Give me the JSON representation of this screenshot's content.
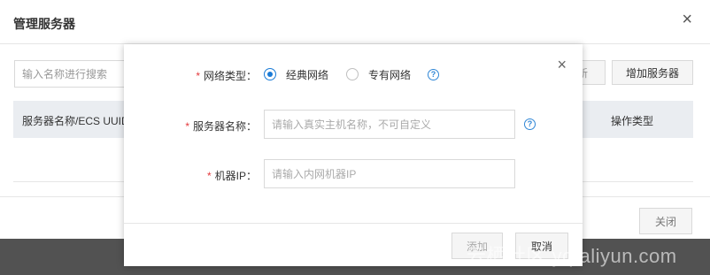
{
  "outer_dialog": {
    "title": "管理服务器",
    "close_symbol": "×",
    "search_placeholder": "输入名称进行搜索",
    "refresh_label": "新",
    "add_server_label": "增加服务器",
    "table_headers": {
      "server": "服务器名称/ECS UUID",
      "operation": "操作类型"
    },
    "close_button_label": "关闭"
  },
  "add_modal": {
    "close_symbol": "×",
    "required_mark": "*",
    "network_type": {
      "label": "网络类型：",
      "options": [
        "经典网络",
        "专有网络"
      ],
      "selected": "经典网络"
    },
    "server_name": {
      "label": "服务器名称：",
      "placeholder": "请输入真实主机名称，不可自定义",
      "value": ""
    },
    "machine_ip": {
      "label": "机器IP：",
      "placeholder": "请输入内网机器IP",
      "value": ""
    },
    "help_symbol": "?",
    "add_button_label": "添加",
    "cancel_button_label": "取消"
  },
  "watermark": "云栖社区 yq.aliyun.com",
  "colors": {
    "accent": "#1a7bd6",
    "required": "#e4393c",
    "table_header_bg": "#eaedf1",
    "overlay": "#525252"
  },
  "icons": {
    "close": "close-icon",
    "help": "help-circle-icon"
  }
}
